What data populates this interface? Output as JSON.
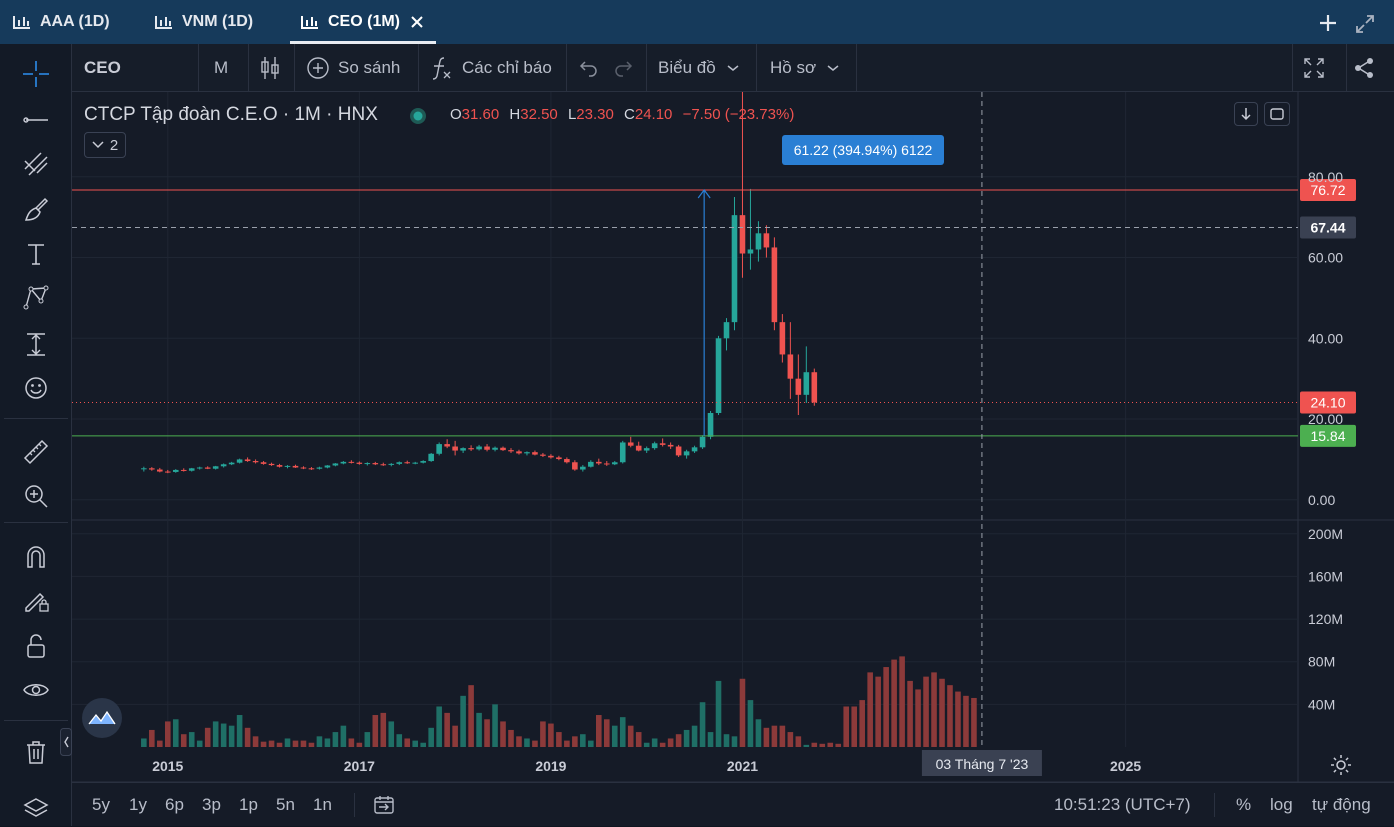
{
  "tabs": [
    {
      "label": "AAA (1D)",
      "active": false
    },
    {
      "label": "VNM (1D)",
      "active": false
    },
    {
      "label": "CEO (1M)",
      "active": true
    }
  ],
  "toolbar": {
    "symbol": "CEO",
    "interval": "M",
    "compare": "So sánh",
    "indicators": "Các chỉ báo",
    "chart_menu": "Biểu đồ",
    "profile_menu": "Hồ sơ"
  },
  "legend": {
    "title": "CTCP Tập đoàn C.E.O · 1M · HNX",
    "open_label": "O",
    "open": "31.60",
    "high_label": "H",
    "high": "32.50",
    "low_label": "L",
    "low": "23.30",
    "close_label": "C",
    "close": "24.10",
    "change": "−7.50 (−23.73%)",
    "collapse_count": "2"
  },
  "measure_label": "61.22 (394.94%) 6122",
  "crosshair_date": "03 Tháng 7 '23",
  "timeframes": [
    "5y",
    "1y",
    "6p",
    "3p",
    "1p",
    "5n",
    "1n"
  ],
  "footer": {
    "time": "10:51:23 (UTC+7)",
    "percent": "%",
    "log": "log",
    "auto": "tự động"
  },
  "colors": {
    "up": "#26a69a",
    "down": "#ef5350",
    "accent": "#2a7fd4",
    "resistance": "#ef5350",
    "support": "#4caf50",
    "background": "#151b27"
  },
  "chart_data": {
    "type": "candlestick",
    "price_axis": {
      "ticks": [
        0,
        20,
        40,
        60,
        80
      ],
      "tick_labels": [
        "0.00",
        "20.00",
        "40.00",
        "60.00",
        "80.00"
      ],
      "range": [
        -5,
        101
      ]
    },
    "volume_axis": {
      "ticks": [
        40,
        80,
        120,
        160,
        200
      ],
      "tick_labels": [
        "40M",
        "80M",
        "120M",
        "160M",
        "200M"
      ],
      "unit": "M"
    },
    "x_axis": {
      "tick_labels": [
        "2015",
        "2017",
        "2019",
        "2021",
        "2025"
      ],
      "tick_years": [
        2015,
        2017,
        2019,
        2021,
        2025
      ],
      "range": [
        2014.0,
        2026.8
      ]
    },
    "price_labels": [
      {
        "value": 76.72,
        "label": "76.72",
        "kind": "resistance"
      },
      {
        "value": 67.44,
        "label": "67.44",
        "kind": "crosshair"
      },
      {
        "value": 24.1,
        "label": "24.10",
        "kind": "last"
      },
      {
        "value": 15.84,
        "label": "15.84",
        "kind": "support"
      }
    ],
    "measure": {
      "from": 15.84,
      "to": 76.72,
      "year": 2020.6
    },
    "crosshair_year": 2023.5,
    "crosshair_price": 67.44,
    "start_year": 2014.75,
    "candles": [
      [
        7.6,
        8.2,
        7.0,
        7.8
      ],
      [
        7.8,
        8.1,
        7.2,
        7.5
      ],
      [
        7.5,
        7.9,
        6.8,
        7.0
      ],
      [
        7.0,
        7.4,
        6.6,
        6.9
      ],
      [
        6.9,
        7.6,
        6.7,
        7.4
      ],
      [
        7.4,
        7.8,
        7.0,
        7.2
      ],
      [
        7.2,
        7.9,
        7.0,
        7.8
      ],
      [
        7.8,
        8.2,
        7.5,
        8.0
      ],
      [
        8.0,
        8.3,
        7.6,
        7.7
      ],
      [
        7.7,
        8.4,
        7.5,
        8.3
      ],
      [
        8.3,
        9.0,
        8.0,
        8.8
      ],
      [
        8.8,
        9.4,
        8.6,
        9.2
      ],
      [
        9.2,
        10.2,
        9.0,
        10.0
      ],
      [
        10.0,
        10.5,
        9.4,
        9.6
      ],
      [
        9.6,
        10.0,
        9.0,
        9.3
      ],
      [
        9.3,
        9.6,
        8.7,
        8.9
      ],
      [
        8.9,
        9.2,
        8.4,
        8.6
      ],
      [
        8.6,
        8.9,
        8.0,
        8.2
      ],
      [
        8.2,
        8.6,
        7.8,
        8.4
      ],
      [
        8.4,
        8.7,
        7.9,
        8.0
      ],
      [
        8.0,
        8.3,
        7.6,
        7.8
      ],
      [
        7.8,
        8.1,
        7.4,
        7.7
      ],
      [
        7.7,
        8.2,
        7.5,
        8.0
      ],
      [
        8.0,
        8.6,
        7.8,
        8.5
      ],
      [
        8.5,
        9.1,
        8.3,
        9.0
      ],
      [
        9.0,
        9.6,
        8.8,
        9.4
      ],
      [
        9.4,
        9.8,
        9.0,
        9.2
      ],
      [
        9.2,
        9.5,
        8.7,
        8.9
      ],
      [
        8.9,
        9.3,
        8.5,
        9.1
      ],
      [
        9.1,
        9.4,
        8.6,
        8.8
      ],
      [
        8.8,
        9.2,
        8.4,
        8.7
      ],
      [
        8.7,
        9.1,
        8.3,
        8.9
      ],
      [
        8.9,
        9.5,
        8.6,
        9.3
      ],
      [
        9.3,
        9.7,
        8.9,
        9.1
      ],
      [
        9.1,
        9.4,
        8.8,
        9.2
      ],
      [
        9.2,
        9.8,
        9.0,
        9.6
      ],
      [
        9.6,
        11.6,
        9.4,
        11.4
      ],
      [
        11.4,
        14.2,
        11.0,
        13.8
      ],
      [
        13.8,
        15.0,
        12.8,
        13.2
      ],
      [
        13.2,
        14.6,
        11.0,
        12.2
      ],
      [
        12.2,
        13.0,
        11.6,
        12.8
      ],
      [
        12.8,
        13.5,
        12.1,
        12.5
      ],
      [
        12.5,
        13.6,
        12.2,
        13.2
      ],
      [
        13.2,
        13.8,
        12.0,
        12.4
      ],
      [
        12.4,
        13.2,
        12.0,
        12.9
      ],
      [
        12.9,
        13.2,
        12.1,
        12.3
      ],
      [
        12.3,
        12.8,
        11.6,
        12.0
      ],
      [
        12.0,
        12.4,
        11.2,
        11.5
      ],
      [
        11.5,
        12.0,
        11.0,
        11.8
      ],
      [
        11.8,
        12.2,
        11.0,
        11.2
      ],
      [
        11.2,
        11.6,
        10.6,
        10.9
      ],
      [
        10.9,
        11.3,
        10.2,
        10.5
      ],
      [
        10.5,
        10.9,
        9.8,
        10.1
      ],
      [
        10.1,
        10.5,
        9.0,
        9.3
      ],
      [
        9.3,
        9.8,
        7.2,
        7.5
      ],
      [
        7.5,
        8.6,
        7.0,
        8.2
      ],
      [
        8.2,
        9.8,
        8.0,
        9.4
      ],
      [
        9.4,
        10.2,
        8.6,
        9.0
      ],
      [
        9.0,
        9.6,
        8.4,
        8.8
      ],
      [
        8.8,
        9.6,
        8.6,
        9.3
      ],
      [
        9.3,
        14.6,
        9.0,
        14.2
      ],
      [
        14.2,
        15.6,
        13.0,
        13.4
      ],
      [
        13.4,
        14.4,
        12.0,
        12.2
      ],
      [
        12.2,
        13.2,
        11.6,
        12.8
      ],
      [
        12.8,
        14.4,
        12.4,
        14.0
      ],
      [
        14.0,
        15.2,
        13.2,
        13.6
      ],
      [
        13.6,
        14.2,
        12.6,
        13.2
      ],
      [
        13.2,
        13.6,
        10.6,
        11.0
      ],
      [
        11.0,
        12.4,
        10.2,
        12.0
      ],
      [
        12.0,
        13.4,
        11.6,
        13.0
      ],
      [
        13.0,
        16.0,
        12.6,
        15.6
      ],
      [
        15.6,
        22.0,
        15.0,
        21.5
      ],
      [
        21.5,
        40.6,
        21.0,
        40.0
      ],
      [
        40.0,
        45.0,
        37.0,
        44.0
      ],
      [
        44.0,
        75.0,
        42.0,
        70.5
      ],
      [
        70.5,
        101.0,
        55.0,
        61.0
      ],
      [
        61.0,
        77.0,
        57.0,
        62.0
      ],
      [
        62.0,
        69.0,
        59.0,
        66.0
      ],
      [
        66.0,
        68.0,
        60.0,
        62.5
      ],
      [
        62.5,
        65.0,
        42.0,
        44.0
      ],
      [
        44.0,
        46.0,
        34.0,
        36.0
      ],
      [
        36.0,
        44.0,
        25.0,
        30.0
      ],
      [
        30.0,
        36.0,
        21.0,
        26.0
      ],
      [
        26.0,
        38.0,
        24.0,
        31.6
      ],
      [
        31.6,
        32.5,
        23.3,
        24.1
      ]
    ],
    "volumes": [
      8,
      16,
      6,
      24,
      26,
      12,
      14,
      6,
      18,
      24,
      22,
      20,
      30,
      18,
      10,
      5,
      6,
      4,
      8,
      6,
      6,
      4,
      10,
      8,
      14,
      20,
      8,
      4,
      14,
      30,
      32,
      24,
      12,
      8,
      6,
      4,
      18,
      38,
      32,
      20,
      48,
      58,
      32,
      26,
      40,
      24,
      16,
      10,
      8,
      6,
      24,
      22,
      14,
      6,
      10,
      12,
      6,
      30,
      26,
      20,
      28,
      20,
      14,
      4,
      8,
      4,
      8,
      12,
      16,
      20,
      42,
      14,
      62,
      12,
      10,
      64,
      44,
      26,
      18,
      20,
      20,
      14,
      10,
      2,
      4,
      3,
      4,
      3,
      38,
      38,
      44,
      70,
      66,
      75,
      82,
      85,
      62,
      54,
      66,
      70,
      64,
      58,
      52,
      48,
      46
    ]
  }
}
